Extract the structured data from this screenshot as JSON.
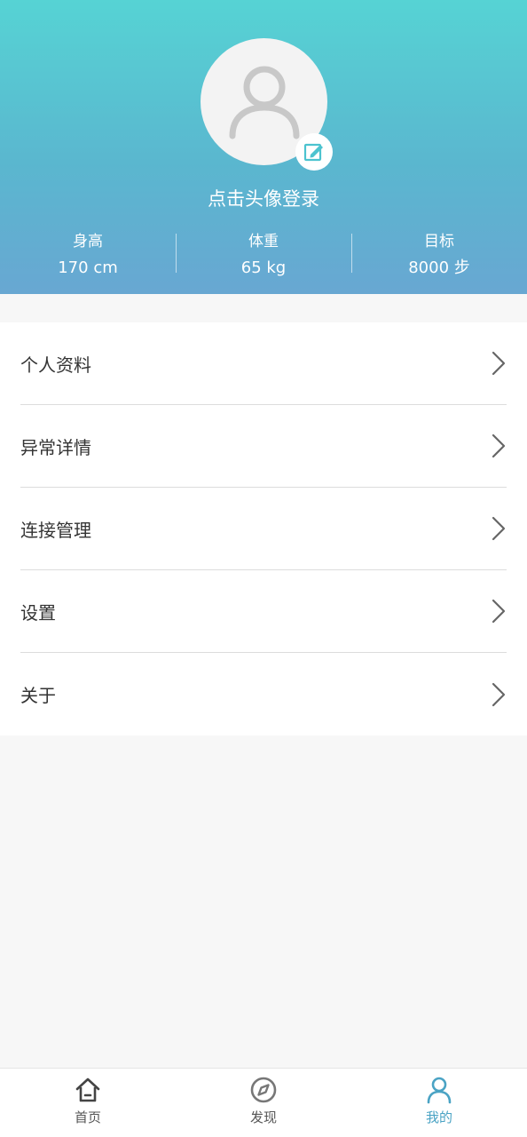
{
  "profile": {
    "login_prompt": "点击头像登录"
  },
  "stats": [
    {
      "label": "身高",
      "value": "170 cm"
    },
    {
      "label": "体重",
      "value": "65 kg"
    },
    {
      "label": "目标",
      "value": "8000 步"
    }
  ],
  "menu": {
    "items": [
      {
        "label": "个人资料"
      },
      {
        "label": "异常详情"
      },
      {
        "label": "连接管理"
      },
      {
        "label": "设置"
      },
      {
        "label": "关于"
      }
    ]
  },
  "bottom_nav": {
    "items": [
      {
        "label": "首页",
        "icon": "home-icon"
      },
      {
        "label": "发现",
        "icon": "compass-icon"
      },
      {
        "label": "我的",
        "icon": "person-icon"
      }
    ],
    "active_index": 2
  },
  "colors": {
    "header_gradient_top": "#56d3d4",
    "header_gradient_bottom": "#68a7d2",
    "accent": "#4aa3c4",
    "page_background": "#f7f7f7"
  }
}
